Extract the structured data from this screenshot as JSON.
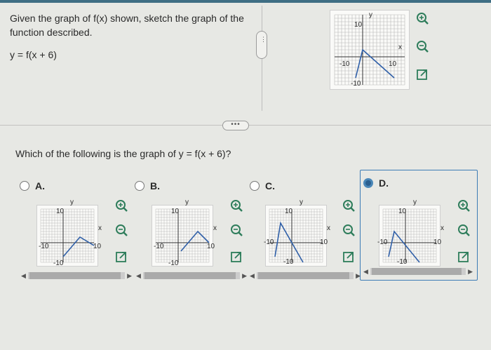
{
  "question": {
    "prompt": "Given the graph of f(x) shown, sketch the graph of the function described.",
    "function": "y = f(x + 6)",
    "which": "Which of the following is the graph of y = f(x + 6)?"
  },
  "reference_graph": {
    "y_label": "y",
    "x_label": "x",
    "tick_top": "10",
    "tick_left": "-10",
    "tick_right": "10",
    "tick_bottom": "-10"
  },
  "options": [
    {
      "label": "A.",
      "selected": false,
      "y_label": "y",
      "x_label": "x",
      "tick_top": "10",
      "tick_left": "-10",
      "tick_right": "10",
      "tick_bottom": "-10"
    },
    {
      "label": "B.",
      "selected": false,
      "y_label": "y",
      "x_label": "x",
      "tick_top": "10",
      "tick_left": "-10",
      "tick_right": "10",
      "tick_bottom": "-10"
    },
    {
      "label": "C.",
      "selected": false,
      "y_label": "y",
      "x_label": "x",
      "tick_top": "10",
      "tick_left": "-10",
      "tick_right": "10",
      "tick_bottom": "-10"
    },
    {
      "label": "D.",
      "selected": true,
      "y_label": "y",
      "x_label": "x",
      "tick_top": "10",
      "tick_left": "-10",
      "tick_right": "10",
      "tick_bottom": "-10"
    }
  ],
  "icons": {
    "zoom_in": "zoom-in-icon",
    "zoom_out": "zoom-out-icon",
    "popout": "popout-icon"
  },
  "colors": {
    "accent": "#3f6e84",
    "curve": "#2f5fa8",
    "selected": "#3c7bb5"
  }
}
